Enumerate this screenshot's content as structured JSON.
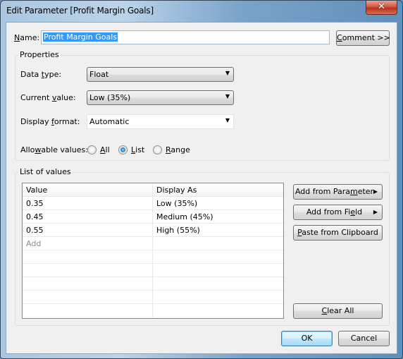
{
  "window": {
    "title": "Edit Parameter [Profit Margin Goals]",
    "close_icon": "close-x-icon"
  },
  "name_row": {
    "label_underlined": "N",
    "label_rest": "ame:",
    "value": "Profit Margin Goals",
    "comment_button_underlined": "C",
    "comment_button_rest": "omment >>"
  },
  "properties": {
    "group_label": "Properties",
    "data_type": {
      "label_pre": "Data ",
      "label_underlined": "t",
      "label_post": "ype:",
      "value": "Float"
    },
    "current_value": {
      "label_pre": "Current ",
      "label_underlined": "v",
      "label_post": "alue:",
      "value": "Low (35%)"
    },
    "display_format": {
      "label_pre": "Display ",
      "label_underlined": "f",
      "label_post": "ormat:",
      "value": "Automatic"
    },
    "allowable_values": {
      "label_pre": "Allo",
      "label_underlined": "w",
      "label_post": "able values:",
      "options": [
        {
          "underlined": "A",
          "rest": "ll",
          "checked": false
        },
        {
          "underlined": "L",
          "rest": "ist",
          "checked": true
        },
        {
          "underlined": "R",
          "rest": "ange",
          "checked": false
        }
      ]
    }
  },
  "list_of_values": {
    "group_label": "List of values",
    "columns": [
      "Value",
      "Display As"
    ],
    "rows": [
      {
        "value": "0.35",
        "display": "Low (35%)"
      },
      {
        "value": "0.45",
        "display": "Medium (45%)"
      },
      {
        "value": "0.55",
        "display": "High (55%)"
      }
    ],
    "add_placeholder": "Add",
    "buttons": {
      "add_from_parameter": {
        "pre": "Add from Para",
        "underlined": "m",
        "post": "eter"
      },
      "add_from_field": {
        "pre": "Add from Fi",
        "underlined": "e",
        "post": "ld"
      },
      "paste_from_clipboard": {
        "pre": "",
        "underlined": "P",
        "post": "aste from Clipboard"
      },
      "clear_all": {
        "pre": "",
        "underlined": "C",
        "post": "lear All"
      }
    }
  },
  "footer": {
    "ok_label": "OK",
    "cancel_label": "Cancel"
  }
}
